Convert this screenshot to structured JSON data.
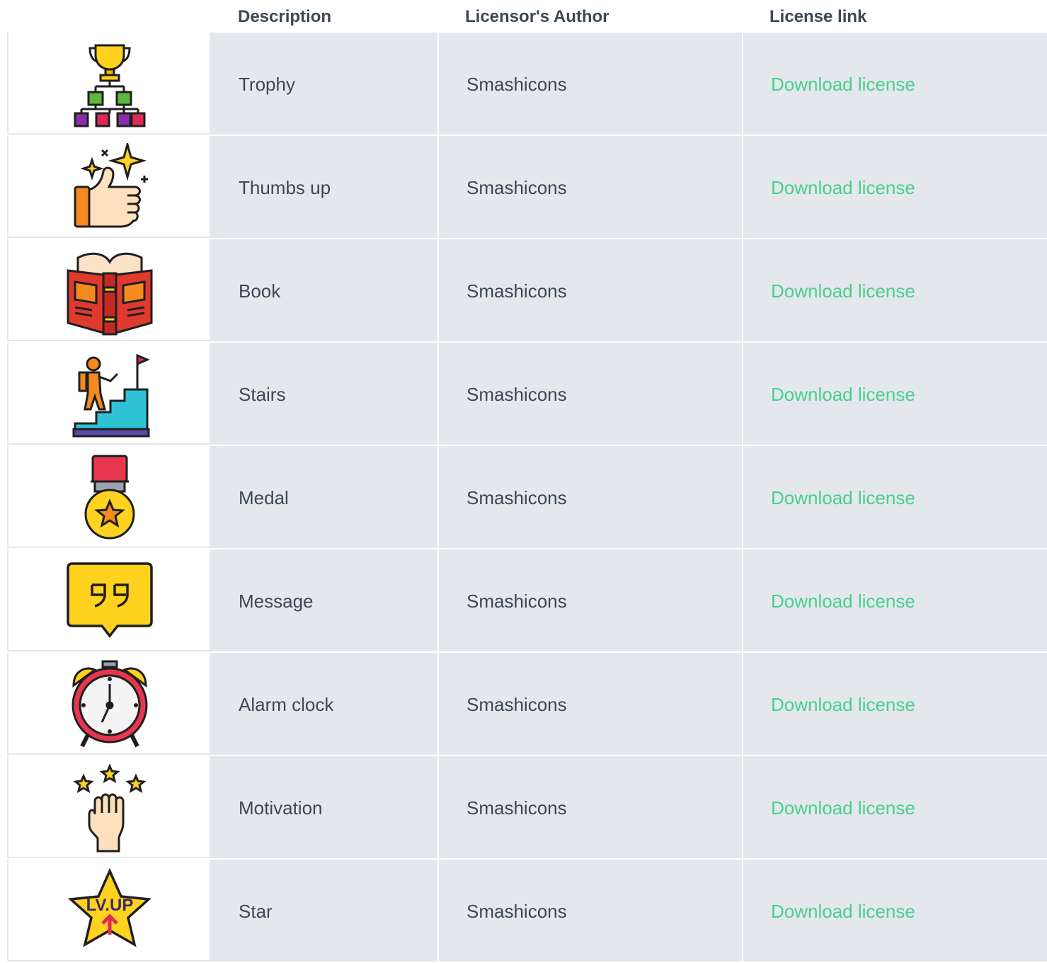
{
  "table": {
    "headers": {
      "description": "Description",
      "author": "Licensor's Author",
      "license_link": "License link"
    },
    "rows": [
      {
        "icon": "trophy-bracket-icon",
        "description": "Trophy",
        "author": "Smashicons",
        "link_label": "Download license"
      },
      {
        "icon": "thumbs-up-icon",
        "description": "Thumbs up",
        "author": "Smashicons",
        "link_label": "Download license"
      },
      {
        "icon": "book-icon",
        "description": "Book",
        "author": "Smashicons",
        "link_label": "Download license"
      },
      {
        "icon": "stairs-icon",
        "description": "Stairs",
        "author": "Smashicons",
        "link_label": "Download license"
      },
      {
        "icon": "medal-icon",
        "description": "Medal",
        "author": "Smashicons",
        "link_label": "Download license"
      },
      {
        "icon": "message-icon",
        "description": "Message",
        "author": "Smashicons",
        "link_label": "Download license"
      },
      {
        "icon": "alarm-clock-icon",
        "description": "Alarm clock",
        "author": "Smashicons",
        "link_label": "Download license"
      },
      {
        "icon": "motivation-icon",
        "description": "Motivation",
        "author": "Smashicons",
        "link_label": "Download license"
      },
      {
        "icon": "star-icon",
        "description": "Star",
        "author": "Smashicons",
        "link_label": "Download license",
        "icon_text": "LV.UP"
      }
    ]
  },
  "colors": {
    "cell_background": "#e4e8ec",
    "text": "#3c4856",
    "link": "#47cf8e"
  }
}
